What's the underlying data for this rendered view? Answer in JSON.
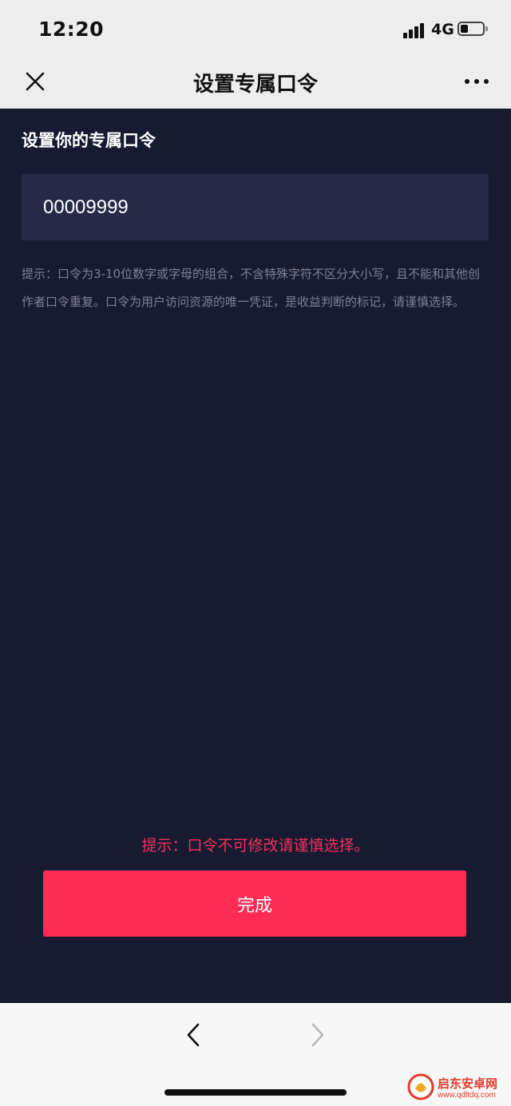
{
  "status_bar": {
    "time": "12:20",
    "network": "4G",
    "battery_icon": "battery-low-icon",
    "signal_icon": "signal-icon"
  },
  "nav": {
    "title": "设置专属口令",
    "close_icon": "close-icon",
    "more_icon": "more-icon"
  },
  "form": {
    "section_title": "设置你的专属口令",
    "code_value": "00009999",
    "hint": "提示：口令为3-10位数字或字母的组合，不含特殊字符不区分大小写，且不能和其他创作者口令重复。口令为用户访问资源的唯一凭证，是收益判断的标记，请谨慎选择。"
  },
  "footer": {
    "warning": "提示：口令不可修改请谨慎选择。",
    "done_label": "完成"
  },
  "browser_bar": {
    "back_icon": "chevron-left-icon",
    "forward_icon": "chevron-right-icon"
  },
  "watermark": {
    "name": "启东安卓网",
    "url": "www.qdltdq.com"
  },
  "colors": {
    "content_bg": "#171a30",
    "input_bg": "#262a47",
    "accent": "#fe2c55",
    "hint_text": "#7d8096",
    "header_bg": "#ededed"
  }
}
